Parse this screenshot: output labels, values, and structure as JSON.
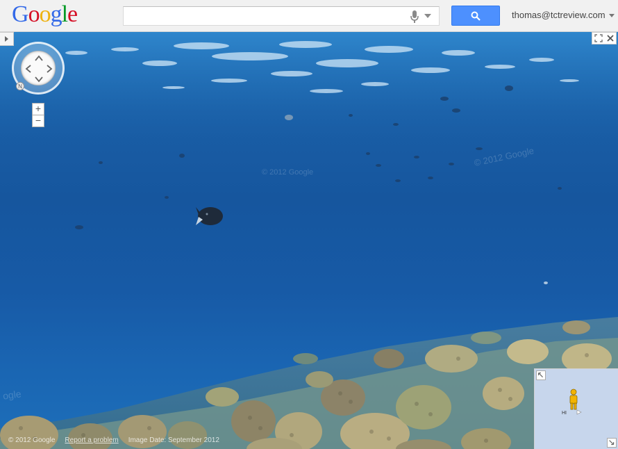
{
  "header": {
    "logo_text": "Google",
    "search": {
      "value": "",
      "placeholder": ""
    },
    "user_email": "thomas@tctreview.com"
  },
  "panorama": {
    "watermarks": [
      "© 2012 Google",
      "© 2012 Google",
      "© 2012 Google"
    ],
    "watermark_left_edge": "ogle",
    "compass_label": "N",
    "zoom_in": "+",
    "zoom_out": "−"
  },
  "footer": {
    "copyright": "© 2012 Google",
    "report": "Report a problem",
    "image_date": "Image Date: September 2012"
  },
  "overview_map": {
    "region_label": "HI"
  },
  "colors": {
    "search_button": "#4d90fe",
    "water_deep": "#16569e",
    "water_surface": "#2f86cc",
    "coral": "#b8b07a",
    "map_background": "#c7d6ec"
  }
}
